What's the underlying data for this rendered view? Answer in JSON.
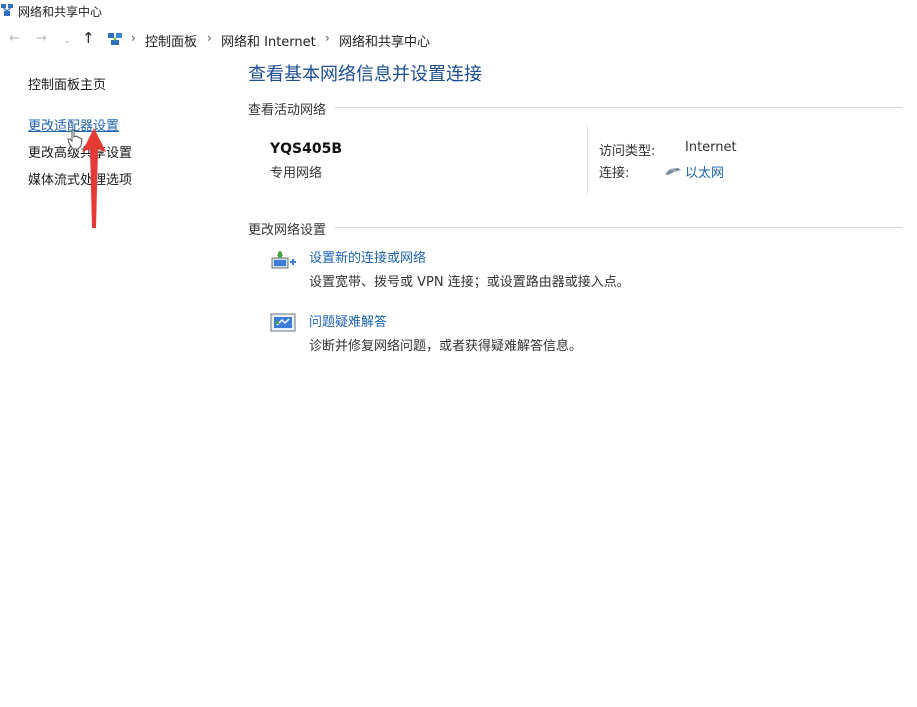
{
  "window": {
    "title": "网络和共享中心"
  },
  "nav": {
    "back": "←",
    "forward": "→",
    "dropdown": "⌄",
    "up": "↑",
    "separator": "›",
    "breadcrumbs": [
      "控制面板",
      "网络和 Internet",
      "网络和共享中心"
    ]
  },
  "sidebar": {
    "items": [
      {
        "label": "控制面板主页"
      },
      {
        "label": "更改适配器设置"
      },
      {
        "label": "更改高级共享设置"
      },
      {
        "label": "媒体流式处理选项"
      }
    ]
  },
  "main": {
    "title": "查看基本网络信息并设置连接",
    "active_section": "查看活动网络",
    "network": {
      "name": "YQS405B",
      "type": "专用网络",
      "access_label": "访问类型:",
      "access_value": "Internet",
      "conn_label": "连接:",
      "conn_value": "以太网"
    },
    "change_section": "更改网络设置",
    "tasks": [
      {
        "link": "设置新的连接或网络",
        "desc": "设置宽带、拨号或 VPN 连接；或设置路由器或接入点。"
      },
      {
        "link": "问题疑难解答",
        "desc": "诊断并修复网络问题，或者获得疑难解答信息。"
      }
    ]
  },
  "colors": {
    "link": "#1e63b0",
    "title": "#1e4e96",
    "annotation_arrow": "#e53935"
  }
}
